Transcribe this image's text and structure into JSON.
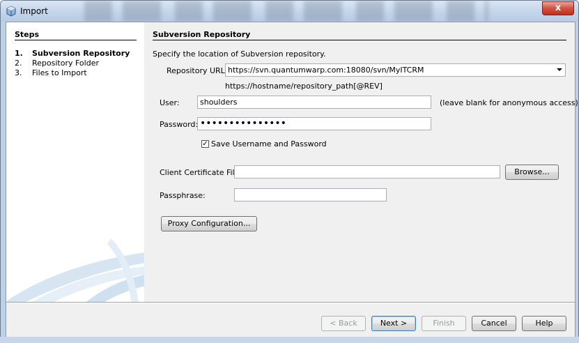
{
  "window": {
    "title": "Import",
    "close_label": "x"
  },
  "steps": {
    "heading": "Steps",
    "items": [
      {
        "num": "1.",
        "label": "Subversion Repository"
      },
      {
        "num": "2.",
        "label": "Repository Folder"
      },
      {
        "num": "3.",
        "label": "Files to Import"
      }
    ]
  },
  "main": {
    "heading": "Subversion Repository",
    "instruction": "Specify the location of Subversion repository.",
    "repo_url_label": "Repository URL:",
    "repo_url_value": "https://svn.quantumwarp.com:18080/svn/MyITCRM",
    "repo_url_hint": "https://hostname/repository_path[@REV]",
    "user_label": "User:",
    "user_value": "shoulders",
    "user_hint": "(leave blank for anonymous access)",
    "password_label": "Password:",
    "password_value": "•••••••••••••••",
    "save_checkbox_label": "Save Username and Password",
    "save_checked": true,
    "client_cert_label": "Client Certificate File:",
    "client_cert_value": "",
    "browse_label": "Browse...",
    "passphrase_label": "Passphrase:",
    "passphrase_value": "",
    "proxy_label": "Proxy Configuration..."
  },
  "footer": {
    "back_label": "< Back",
    "next_label": "Next >",
    "finish_label": "Finish",
    "cancel_label": "Cancel",
    "help_label": "Help"
  }
}
